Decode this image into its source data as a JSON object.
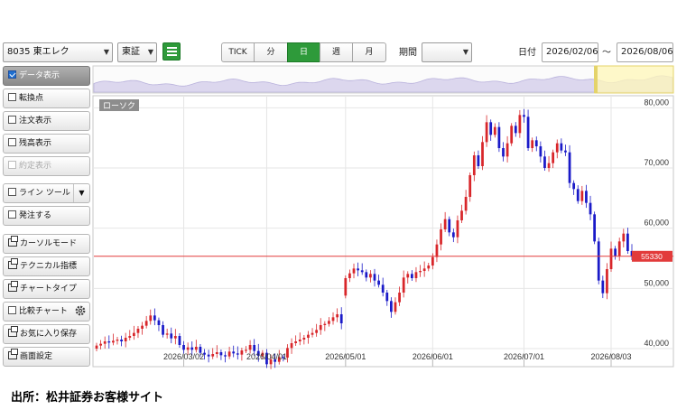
{
  "toolbar": {
    "symbol": "8035 東エレク",
    "market": "東証",
    "intervals": [
      "TICK",
      "分",
      "日",
      "週",
      "月"
    ],
    "active_interval": "日",
    "period_label": "期間",
    "period_value": "",
    "date_label": "日付",
    "date_from": "2026/02/06",
    "date_sep": "～",
    "date_to": "2026/08/06"
  },
  "sidebar": {
    "items": [
      {
        "label": "データ表示",
        "kind": "checkbox",
        "checked": true,
        "active": true
      },
      {
        "label": "転換点",
        "kind": "checkbox",
        "checked": false
      },
      {
        "label": "注文表示",
        "kind": "checkbox",
        "checked": false
      },
      {
        "label": "残高表示",
        "kind": "checkbox",
        "checked": false
      },
      {
        "label": "約定表示",
        "kind": "checkbox",
        "checked": false,
        "disabled": true
      },
      {
        "label": "ライン ツール",
        "kind": "checkbox-dropdown",
        "checked": false
      },
      {
        "label": "発注する",
        "kind": "checkbox",
        "checked": false
      },
      {
        "label": "カーソルモード",
        "kind": "window"
      },
      {
        "label": "テクニカル指標",
        "kind": "window"
      },
      {
        "label": "チャートタイプ",
        "kind": "window"
      },
      {
        "label": "比較チャート",
        "kind": "checkbox-gear",
        "checked": false
      },
      {
        "label": "お気に入り保存",
        "kind": "window"
      },
      {
        "label": "画面設定",
        "kind": "window"
      }
    ]
  },
  "chart": {
    "type_label": "ローソク",
    "current_price_label": "55330",
    "up_color": "#d8262a",
    "down_color": "#1a1ac8",
    "price_line_color": "#e23b3b"
  },
  "chart_data": {
    "type": "candlestick",
    "ylim": [
      37000,
      82000
    ],
    "yticks": [
      "80,000",
      "70,000",
      "60,000",
      "50,000",
      "40,000"
    ],
    "yticks_values": [
      80000,
      70000,
      60000,
      50000,
      40000
    ],
    "xticks": [
      "2026/03/02",
      "2026/04/01",
      "2026/05/01",
      "2026/06/01",
      "2026/07/01",
      "2026/08/03"
    ],
    "xticks_index": [
      21,
      41,
      60,
      81,
      103,
      124
    ],
    "current_price": 55330,
    "closes": [
      40500,
      40800,
      41200,
      41000,
      41300,
      41500,
      41200,
      41800,
      42100,
      42600,
      43300,
      43800,
      44600,
      45500,
      44700,
      43900,
      42300,
      42500,
      41700,
      42100,
      40600,
      39800,
      40200,
      39800,
      40300,
      39300,
      39000,
      38700,
      39100,
      39400,
      38900,
      38700,
      39500,
      39200,
      39000,
      39700,
      39800,
      40600,
      39600,
      38800,
      39300,
      37400,
      38200,
      37800,
      38600,
      38500,
      40100,
      40900,
      41200,
      41500,
      41800,
      42300,
      42600,
      43100,
      43900,
      44100,
      44600,
      45200,
      45700,
      44200,
      51700,
      52500,
      53300,
      53000,
      52700,
      51800,
      52400,
      51300,
      50600,
      49300,
      47900,
      46100,
      47700,
      49300,
      51800,
      52400,
      51700,
      52700,
      52900,
      53300,
      53800,
      55200,
      57300,
      59800,
      61500,
      59300,
      58500,
      61300,
      62900,
      65200,
      68800,
      72100,
      70300,
      74300,
      77600,
      75500,
      76800,
      73300,
      71900,
      74100,
      77000,
      75800,
      78800,
      78500,
      73300,
      74600,
      73600,
      71900,
      70000,
      70800,
      72600,
      74100,
      72900,
      72600,
      67500,
      66500,
      64500,
      66200,
      64200,
      62300,
      57800,
      51300,
      49200,
      53200,
      56600,
      55400,
      57800,
      59100,
      56200,
      55330
    ],
    "opens": [
      40000,
      40500,
      40800,
      41200,
      41000,
      41300,
      41500,
      41200,
      41800,
      42100,
      42600,
      43300,
      43800,
      44600,
      45500,
      44700,
      43900,
      42300,
      42500,
      41700,
      42100,
      40600,
      39800,
      40200,
      39800,
      40300,
      39300,
      39000,
      38700,
      39100,
      39400,
      38900,
      38700,
      39500,
      39200,
      39000,
      39700,
      39800,
      40600,
      39600,
      38800,
      39300,
      37400,
      38200,
      37800,
      38600,
      38500,
      40100,
      40900,
      41200,
      41500,
      41800,
      42300,
      42600,
      43100,
      43900,
      44100,
      44600,
      45200,
      45700,
      48800,
      51700,
      52500,
      53300,
      53000,
      52700,
      51800,
      52400,
      51300,
      50600,
      49300,
      47900,
      46100,
      47700,
      49300,
      51800,
      52400,
      51700,
      52700,
      52900,
      53300,
      53800,
      55200,
      57300,
      59800,
      61500,
      59300,
      58500,
      61300,
      62900,
      65200,
      68800,
      72100,
      70300,
      74300,
      77600,
      75500,
      76800,
      73300,
      71900,
      74100,
      77000,
      75800,
      78800,
      78500,
      73300,
      74600,
      73600,
      71900,
      70000,
      70800,
      72600,
      74100,
      72900,
      72600,
      67500,
      66500,
      64500,
      66200,
      64200,
      62300,
      57800,
      51300,
      49200,
      53200,
      56600,
      55400,
      57800,
      59100,
      56200
    ]
  }
}
